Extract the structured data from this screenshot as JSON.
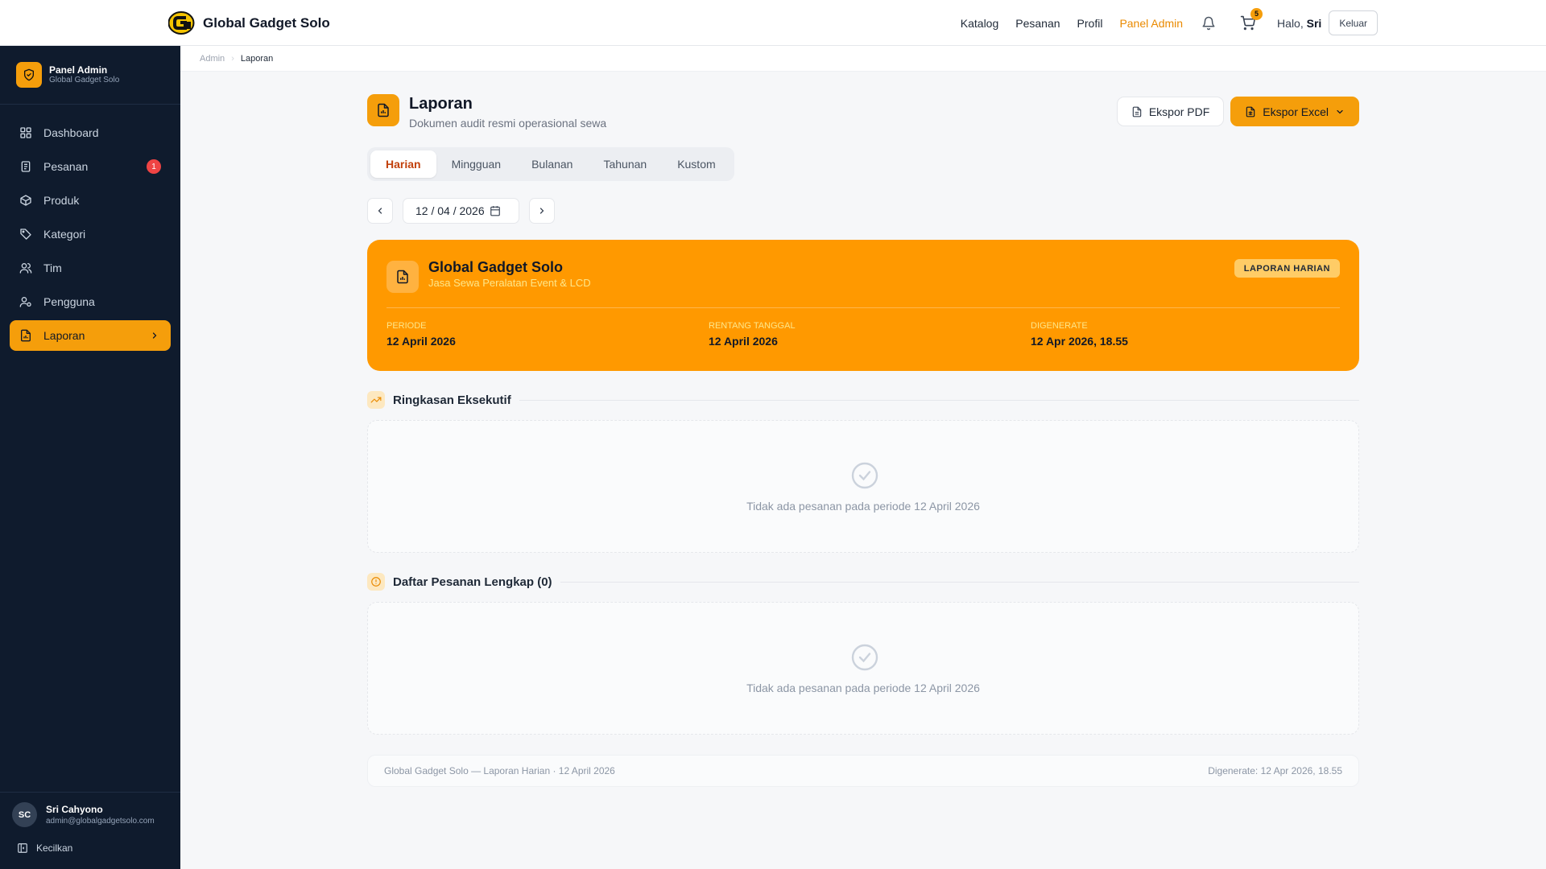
{
  "brand": {
    "name": "Global Gadget Solo"
  },
  "topnav": {
    "links": [
      "Katalog",
      "Pesanan",
      "Profil",
      "Panel Admin"
    ],
    "cart_count": "5",
    "greeting_prefix": "Halo,",
    "greeting_name": "Sri",
    "logout_label": "Keluar"
  },
  "sidebar": {
    "title": "Panel Admin",
    "subtitle": "Global Gadget Solo",
    "items": [
      {
        "label": "Dashboard",
        "icon": "grid-icon"
      },
      {
        "label": "Pesanan",
        "icon": "clipboard-icon",
        "badge": "1"
      },
      {
        "label": "Produk",
        "icon": "box-icon"
      },
      {
        "label": "Kategori",
        "icon": "tag-icon"
      },
      {
        "label": "Tim",
        "icon": "users-icon"
      },
      {
        "label": "Pengguna",
        "icon": "user-cog-icon"
      },
      {
        "label": "Laporan",
        "icon": "report-icon",
        "active": true
      }
    ],
    "user": {
      "initials": "SC",
      "name": "Sri Cahyono",
      "email": "admin@globalgadgetsolo.com"
    },
    "collapse_label": "Kecilkan"
  },
  "breadcrumb": {
    "parent": "Admin",
    "current": "Laporan"
  },
  "page": {
    "title": "Laporan",
    "subtitle": "Dokumen audit resmi operasional sewa",
    "export_pdf": "Ekspor PDF",
    "export_excel": "Ekspor Excel"
  },
  "tabs": [
    "Harian",
    "Mingguan",
    "Bulanan",
    "Tahunan",
    "Kustom"
  ],
  "active_tab": "Harian",
  "date_picker": {
    "value": "12 / 04 / 2026"
  },
  "report_card": {
    "company": "Global Gadget Solo",
    "tagline": "Jasa Sewa Peralatan Event & LCD",
    "badge": "LAPORAN HARIAN",
    "period_label": "PERIODE",
    "period_value": "12 April 2026",
    "range_label": "RENTANG TANGGAL",
    "range_value": "12 April 2026",
    "generated_label": "DIGENERATE",
    "generated_value": "12 Apr 2026, 18.55"
  },
  "summary_section": {
    "title": "Ringkasan Eksekutif",
    "empty_text": "Tidak ada pesanan pada periode 12 April 2026"
  },
  "orders_section": {
    "title": "Daftar Pesanan Lengkap (0)",
    "empty_text": "Tidak ada pesanan pada periode 12 April 2026"
  },
  "footer": {
    "left": "Global Gadget Solo — Laporan Harian · 12 April 2026",
    "right": "Digenerate: 12 Apr 2026, 18.55"
  },
  "colors": {
    "accent": "#f59e0b",
    "hero": "#ff9900",
    "sidebar_bg": "#0f1b2d",
    "active_link": "#ea8a00",
    "badge_red": "#ef4444"
  }
}
